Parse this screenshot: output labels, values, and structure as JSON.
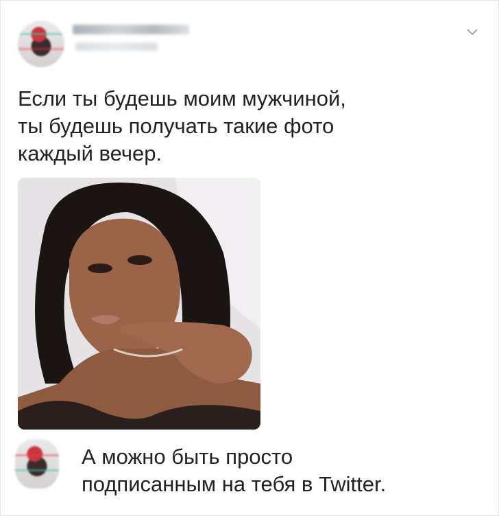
{
  "tweet": {
    "text": "Если ты будешь моим мужчиной,\nты будешь получать такие фото\nкаждый вечер."
  },
  "reply": {
    "text": "А можно быть просто\nподписанным на тебя в Twitter."
  },
  "icons": {
    "menu": "chevron-down-icon"
  },
  "colors": {
    "text": "#222222",
    "border": "#e1e8ed",
    "chevron": "#8899a6"
  }
}
